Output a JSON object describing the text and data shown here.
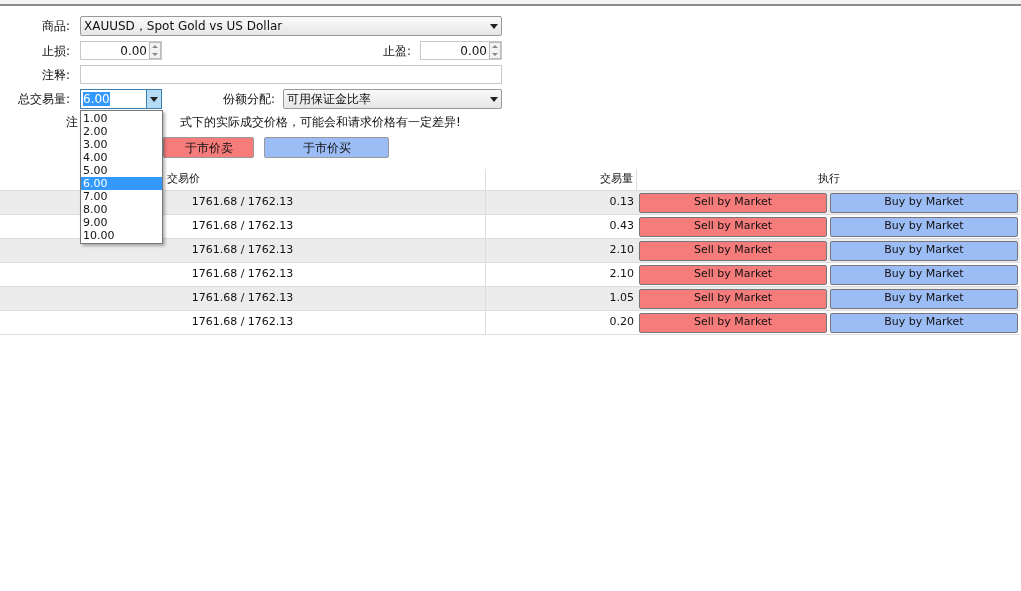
{
  "form": {
    "symbol": {
      "label": "商品:",
      "value": "XAUUSD，Spot Gold vs US Dollar"
    },
    "stop_loss": {
      "label": "止损:",
      "value": "0.00"
    },
    "take_profit": {
      "label": "止盈:",
      "value": "0.00"
    },
    "comment": {
      "label": "注释:"
    },
    "volume": {
      "label": "总交易量:",
      "value": "6.00",
      "expanded": true,
      "options": [
        {
          "label": "1.00",
          "selected": false
        },
        {
          "label": "2.00",
          "selected": false
        },
        {
          "label": "3.00",
          "selected": false
        },
        {
          "label": "4.00",
          "selected": false
        },
        {
          "label": "5.00",
          "selected": false
        },
        {
          "label": "6.00",
          "selected": true
        },
        {
          "label": "7.00",
          "selected": false
        },
        {
          "label": "8.00",
          "selected": false
        },
        {
          "label": "9.00",
          "selected": false
        },
        {
          "label": "10.00",
          "selected": false
        }
      ]
    },
    "allocation": {
      "label": "份额分配:",
      "value": "可用保证金比率"
    },
    "note_start": "注",
    "note_end": "式下的实际成交价格，可能会和请求价格有一定差异!",
    "sell_button": "于市价卖",
    "buy_button": "于市价买"
  },
  "table": {
    "columns": [
      "交易价",
      "交易量",
      "执行"
    ],
    "rows": [
      {
        "price": "1761.68 / 1762.13",
        "volume": "0.13",
        "sell": "Sell by Market",
        "buy": "Buy by Market"
      },
      {
        "price": "1761.68 / 1762.13",
        "volume": "0.43",
        "sell": "Sell by Market",
        "buy": "Buy by Market"
      },
      {
        "price": "1761.68 / 1762.13",
        "volume": "2.10",
        "sell": "Sell by Market",
        "buy": "Buy by Market"
      },
      {
        "price": "1761.68 / 1762.13",
        "volume": "2.10",
        "sell": "Sell by Market",
        "buy": "Buy by Market"
      },
      {
        "price": "1761.68 / 1762.13",
        "volume": "1.05",
        "sell": "Sell by Market",
        "buy": "Buy by Market"
      },
      {
        "price": "1761.68 / 1762.13",
        "volume": "0.20",
        "sell": "Sell by Market",
        "buy": "Buy by Market"
      }
    ]
  }
}
